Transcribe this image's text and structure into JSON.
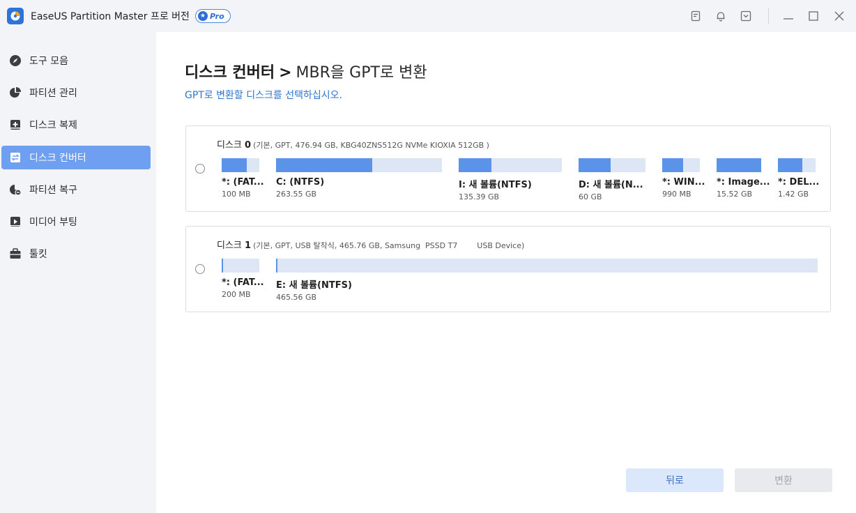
{
  "app": {
    "title": "EaseUS Partition Master 프로 버전",
    "badge": "Pro"
  },
  "titlebar_icons": [
    "notes-icon",
    "bell-icon",
    "dropdown-icon",
    "minimize-icon",
    "maximize-icon",
    "close-icon"
  ],
  "sidebar": {
    "items": [
      {
        "label": "도구 모음",
        "icon": "compass-icon",
        "active": false
      },
      {
        "label": "파티션 관리",
        "icon": "pie-chart-icon",
        "active": false
      },
      {
        "label": "디스크 복제",
        "icon": "clone-icon",
        "active": false
      },
      {
        "label": "디스크 컨버터",
        "icon": "convert-icon",
        "active": true
      },
      {
        "label": "파티션 복구",
        "icon": "recover-icon",
        "active": false
      },
      {
        "label": "미디어 부팅",
        "icon": "media-icon",
        "active": false
      },
      {
        "label": "툴킷",
        "icon": "toolbox-icon",
        "active": false
      }
    ]
  },
  "main": {
    "breadcrumb": "디스크 컨버터",
    "separator": ">",
    "current": "MBR을 GPT로 변환",
    "subtitle": "GPT로 변환할 디스크를 선택하십시오.",
    "disks": [
      {
        "label": "디스크",
        "index": "0",
        "meta": "(기본, GPT, 476.94 GB, KBG40ZNS512G NVMe KIOXIA 512GB )",
        "partitions": [
          {
            "name": "*: (FAT...",
            "size": "100 MB",
            "used_fraction": 0.66
          },
          {
            "name": "C: (NTFS)",
            "size": "263.55 GB",
            "used_fraction": 0.58
          },
          {
            "name": "I: 새 볼륨(NTFS)",
            "size": "135.39 GB",
            "used_fraction": 0.32
          },
          {
            "name": "D: 새 볼륨(N...",
            "size": "60 GB",
            "used_fraction": 0.48
          },
          {
            "name": "*: WIN...",
            "size": "990 MB",
            "used_fraction": 0.56
          },
          {
            "name": "*: Image...",
            "size": "15.52 GB",
            "used_fraction": 1.0
          },
          {
            "name": "*: DEL...",
            "size": "1.42 GB",
            "used_fraction": 0.65
          }
        ]
      },
      {
        "label": "디스크",
        "index": "1",
        "meta": "(기본, GPT, USB 탈착식, 465.76 GB, Samsung  PSSD T7        USB Device)",
        "partitions": [
          {
            "name": "*: (FAT...",
            "size": "200 MB",
            "used_fraction": 0.02
          },
          {
            "name": "E: 새 볼륨(NTFS)",
            "size": "465.56 GB",
            "used_fraction": 0.002
          }
        ]
      }
    ]
  },
  "buttons": {
    "back": "뒤로",
    "convert": "변환"
  },
  "colors": {
    "accent": "#5b93e8",
    "active_nav": "#6f9ff0",
    "bar_bg": "#dde6f5",
    "link": "#2f74d0"
  }
}
